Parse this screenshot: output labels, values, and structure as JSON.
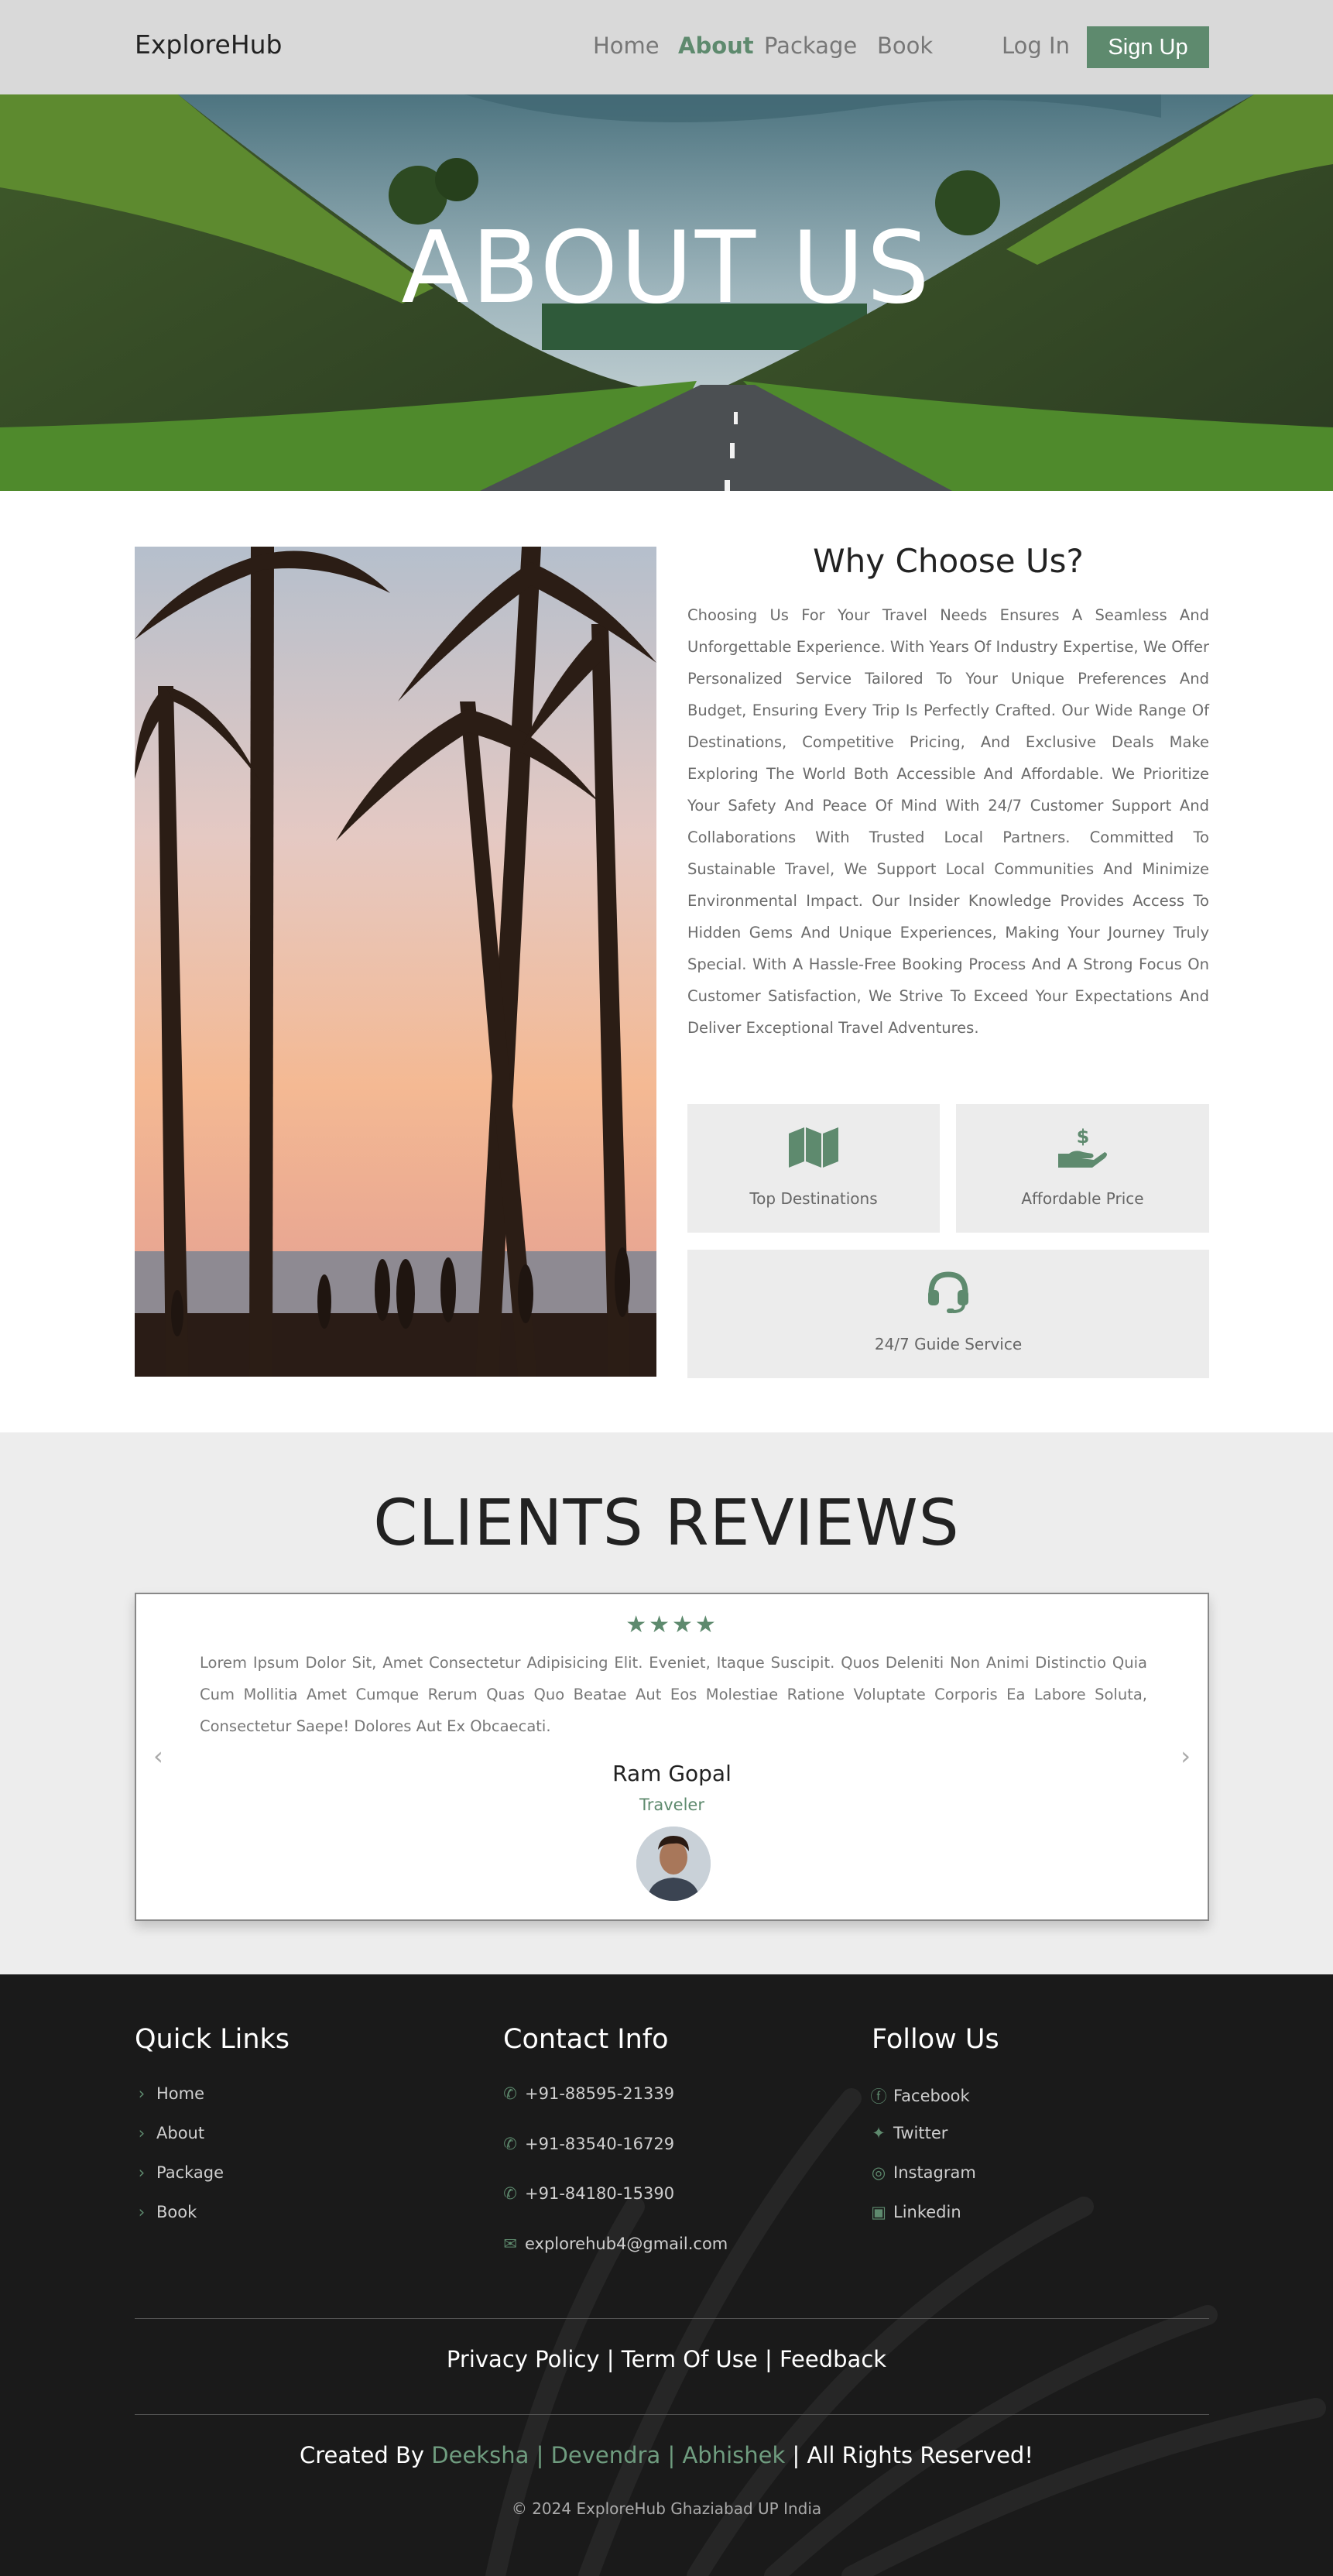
{
  "nav": {
    "logo": "ExploreHub",
    "links": [
      "Home",
      "About",
      "Package",
      "Book"
    ],
    "active": "About",
    "login": "Log In",
    "signup": "Sign Up"
  },
  "hero": {
    "title": "ABOUT US"
  },
  "about": {
    "title": "Why Choose Us?",
    "text": "Choosing Us For Your Travel Needs Ensures A Seamless And Unforgettable Experience. With Years Of Industry Expertise, We Offer Personalized Service Tailored To Your Unique Preferences And Budget, Ensuring Every Trip Is Perfectly Crafted. Our Wide Range Of Destinations, Competitive Pricing, And Exclusive Deals Make Exploring The World Both Accessible And Affordable. We Prioritize Your Safety And Peace Of Mind With 24/7 Customer Support And Collaborations With Trusted Local Partners. Committed To Sustainable Travel, We Support Local Communities And Minimize Environmental Impact. Our Insider Knowledge Provides Access To Hidden Gems And Unique Experiences, Making Your Journey Truly Special. With A Hassle-Free Booking Process And A Strong Focus On Customer Satisfaction, We Strive To Exceed Your Expectations And Deliver Exceptional Travel Adventures.",
    "features": [
      {
        "icon": "map-icon",
        "label": "Top Destinations"
      },
      {
        "icon": "hand-dollar-icon",
        "label": "Affordable Price"
      },
      {
        "icon": "headset-icon",
        "label": "24/7 Guide Service"
      }
    ]
  },
  "reviews": {
    "title": "CLIENTS REVIEWS",
    "stars": "★★★★",
    "rating": 4,
    "text": "Lorem Ipsum Dolor Sit, Amet Consectetur Adipisicing Elit. Eveniet, Itaque Suscipit. Quos Deleniti Non Animi Distinctio Quia Cum Mollitia Amet Cumque Rerum Quas Quo Beatae Aut Eos Molestiae Ratione Voluptate Corporis Ea Labore Soluta, Consectetur Saepe! Dolores Aut Ex Obcaecati.",
    "name": "Ram Gopal",
    "role": "Traveler",
    "prev": "‹",
    "next": "›"
  },
  "footer": {
    "quick_title": "Quick Links",
    "quick_links": [
      "Home",
      "About",
      "Package",
      "Book"
    ],
    "contact_title": "Contact Info",
    "contacts": [
      "+91-88595-21339",
      "+91-83540-16729",
      "+91-84180-15390",
      "explorehub4@gmail.com"
    ],
    "follow_title": "Follow Us",
    "socials": [
      "Facebook",
      "Twitter",
      "Instagram",
      "Linkedin"
    ],
    "policy": [
      "Privacy Policy",
      "Term Of Use",
      "Feedback"
    ],
    "policy_sep": " | ",
    "credits_prefix": "Created By ",
    "credits_names": [
      "Deeksha",
      "Devendra",
      "Abhishek"
    ],
    "credits_suffix": " All Rights Reserved!",
    "copyright": "© 2024 ExploreHub Ghaziabad UP India"
  },
  "colors": {
    "accent": "#5e8a6e",
    "nav_bg": "#d9d9d9",
    "section_bg": "#ededed",
    "footer_bg": "#1a1a1a"
  }
}
